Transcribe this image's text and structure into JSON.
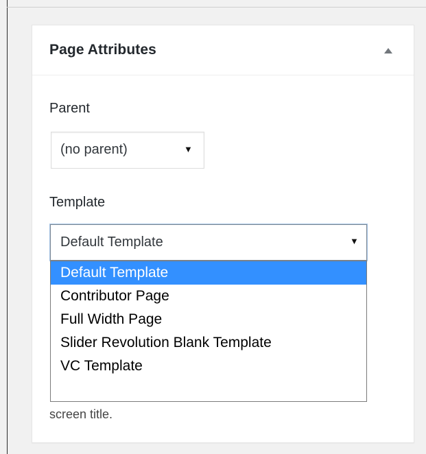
{
  "metabox": {
    "title": "Page Attributes",
    "toggle_icon": "triangle-up-icon"
  },
  "parent": {
    "label": "Parent",
    "selected": "(no parent)",
    "arrow_icon": "caret-down-icon"
  },
  "template": {
    "label": "Template",
    "selected": "Default Template",
    "arrow_icon": "caret-down-icon",
    "options": [
      {
        "label": "Default Template",
        "highlighted": true
      },
      {
        "label": "Contributor Page",
        "highlighted": false
      },
      {
        "label": "Full Width Page",
        "highlighted": false
      },
      {
        "label": "Slider Revolution Blank Template",
        "highlighted": false
      },
      {
        "label": "VC Template",
        "highlighted": false
      }
    ]
  },
  "help": {
    "visible_text": "screen title."
  },
  "colors": {
    "highlight": "#3390ff",
    "focus_ring": "#a6c4e6",
    "border": "#dddddd",
    "text": "#23282d"
  }
}
